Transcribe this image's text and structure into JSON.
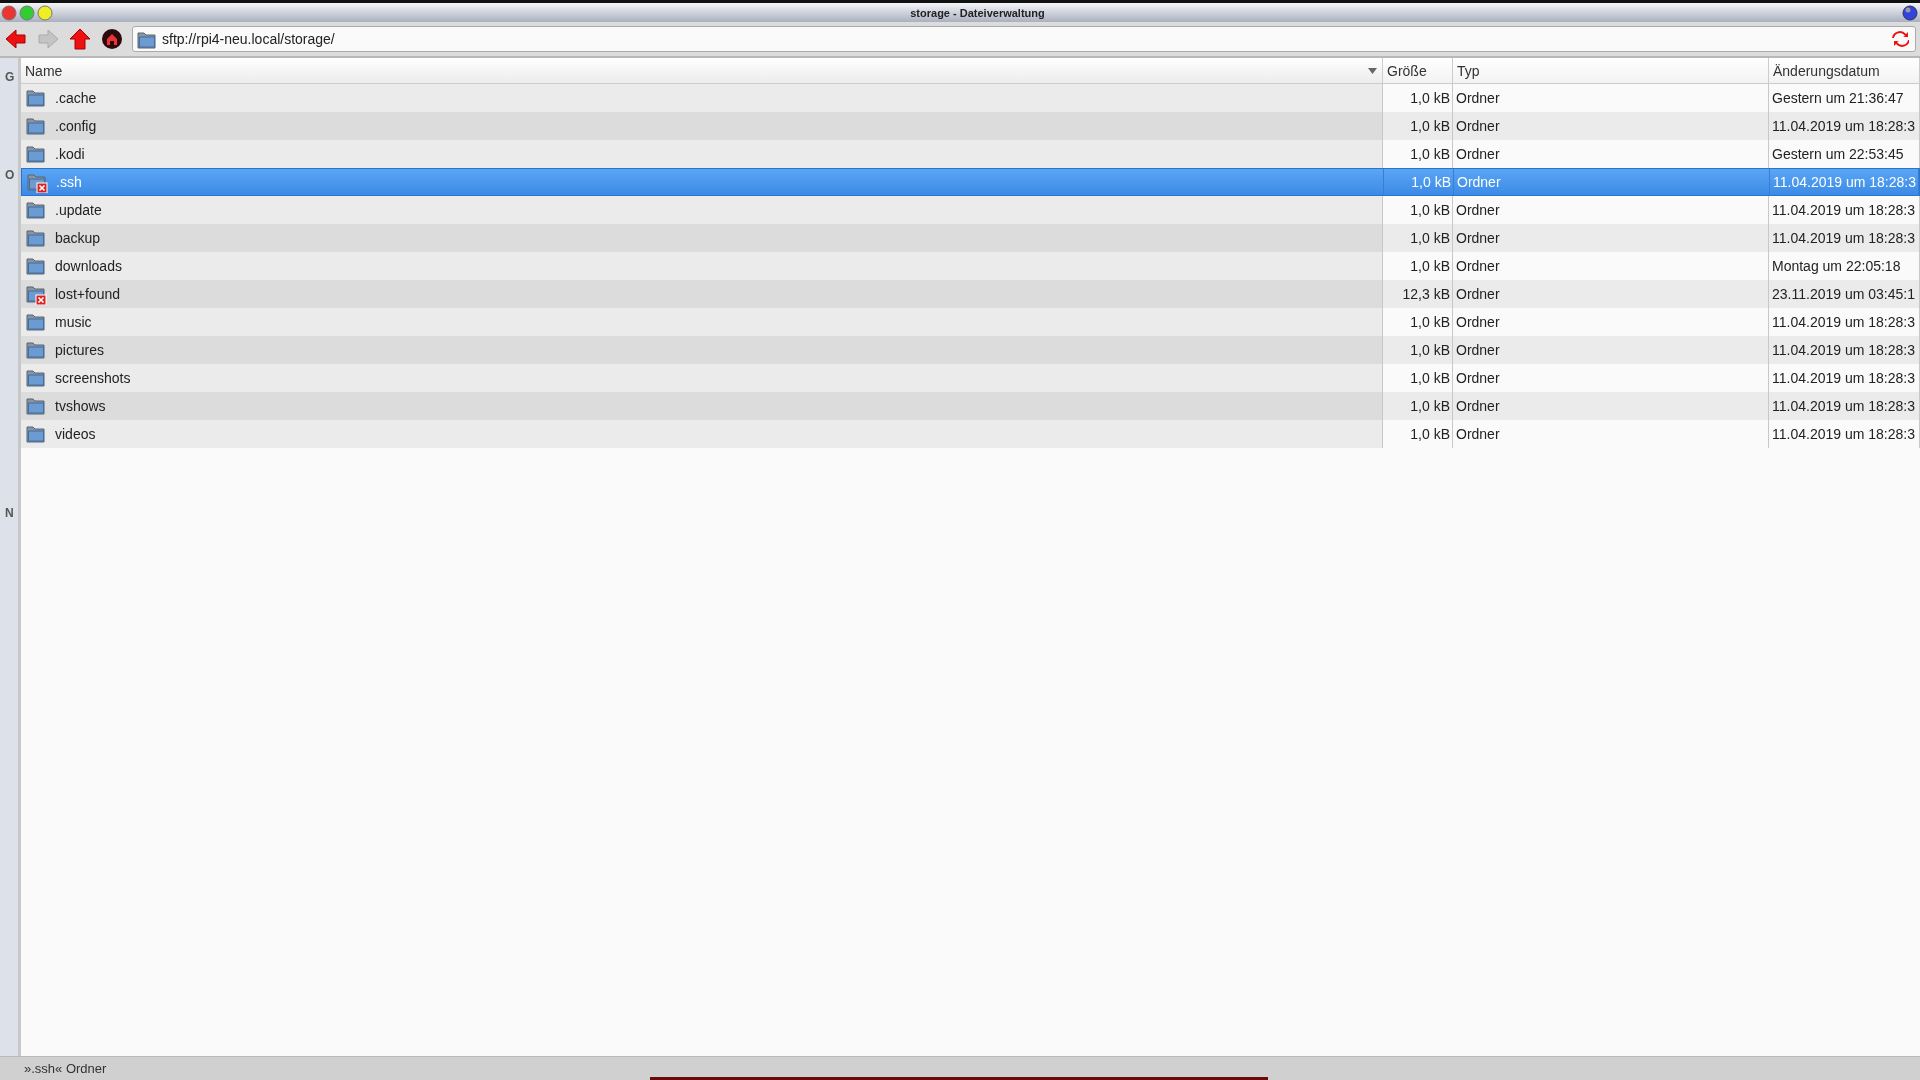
{
  "window": {
    "title": "storage - Dateiverwaltung"
  },
  "toolbar": {
    "location": "sftp://rpi4-neu.local/storage/",
    "back_enabled": true,
    "forward_enabled": false
  },
  "side_panel": {
    "labels": [
      "G",
      "O",
      "N"
    ]
  },
  "table": {
    "columns": [
      {
        "label": "Name",
        "sorted": true
      },
      {
        "label": "Größe",
        "sorted": false
      },
      {
        "label": "Typ",
        "sorted": false
      },
      {
        "label": "Änderungsdatum",
        "sorted": false
      }
    ],
    "rows": [
      {
        "name": ".cache",
        "size": "1,0 kB",
        "type": "Ordner",
        "modified": "Gestern um 21:36:47",
        "locked": false,
        "selected": false
      },
      {
        "name": ".config",
        "size": "1,0 kB",
        "type": "Ordner",
        "modified": "11.04.2019 um 18:28:3",
        "locked": false,
        "selected": false
      },
      {
        "name": ".kodi",
        "size": "1,0 kB",
        "type": "Ordner",
        "modified": "Gestern um 22:53:45",
        "locked": false,
        "selected": false
      },
      {
        "name": ".ssh",
        "size": "1,0 kB",
        "type": "Ordner",
        "modified": "11.04.2019 um 18:28:3",
        "locked": true,
        "selected": true
      },
      {
        "name": ".update",
        "size": "1,0 kB",
        "type": "Ordner",
        "modified": "11.04.2019 um 18:28:3",
        "locked": false,
        "selected": false
      },
      {
        "name": "backup",
        "size": "1,0 kB",
        "type": "Ordner",
        "modified": "11.04.2019 um 18:28:3",
        "locked": false,
        "selected": false
      },
      {
        "name": "downloads",
        "size": "1,0 kB",
        "type": "Ordner",
        "modified": "Montag um 22:05:18",
        "locked": false,
        "selected": false
      },
      {
        "name": "lost+found",
        "size": "12,3 kB",
        "type": "Ordner",
        "modified": "23.11.2019 um 03:45:1",
        "locked": true,
        "selected": false
      },
      {
        "name": "music",
        "size": "1,0 kB",
        "type": "Ordner",
        "modified": "11.04.2019 um 18:28:3",
        "locked": false,
        "selected": false
      },
      {
        "name": "pictures",
        "size": "1,0 kB",
        "type": "Ordner",
        "modified": "11.04.2019 um 18:28:3",
        "locked": false,
        "selected": false
      },
      {
        "name": "screenshots",
        "size": "1,0 kB",
        "type": "Ordner",
        "modified": "11.04.2019 um 18:28:3",
        "locked": false,
        "selected": false
      },
      {
        "name": "tvshows",
        "size": "1,0 kB",
        "type": "Ordner",
        "modified": "11.04.2019 um 18:28:3",
        "locked": false,
        "selected": false
      },
      {
        "name": "videos",
        "size": "1,0 kB",
        "type": "Ordner",
        "modified": "11.04.2019 um 18:28:3",
        "locked": false,
        "selected": false
      }
    ]
  },
  "status_bar": {
    "text": "».ssh« Ordner"
  }
}
